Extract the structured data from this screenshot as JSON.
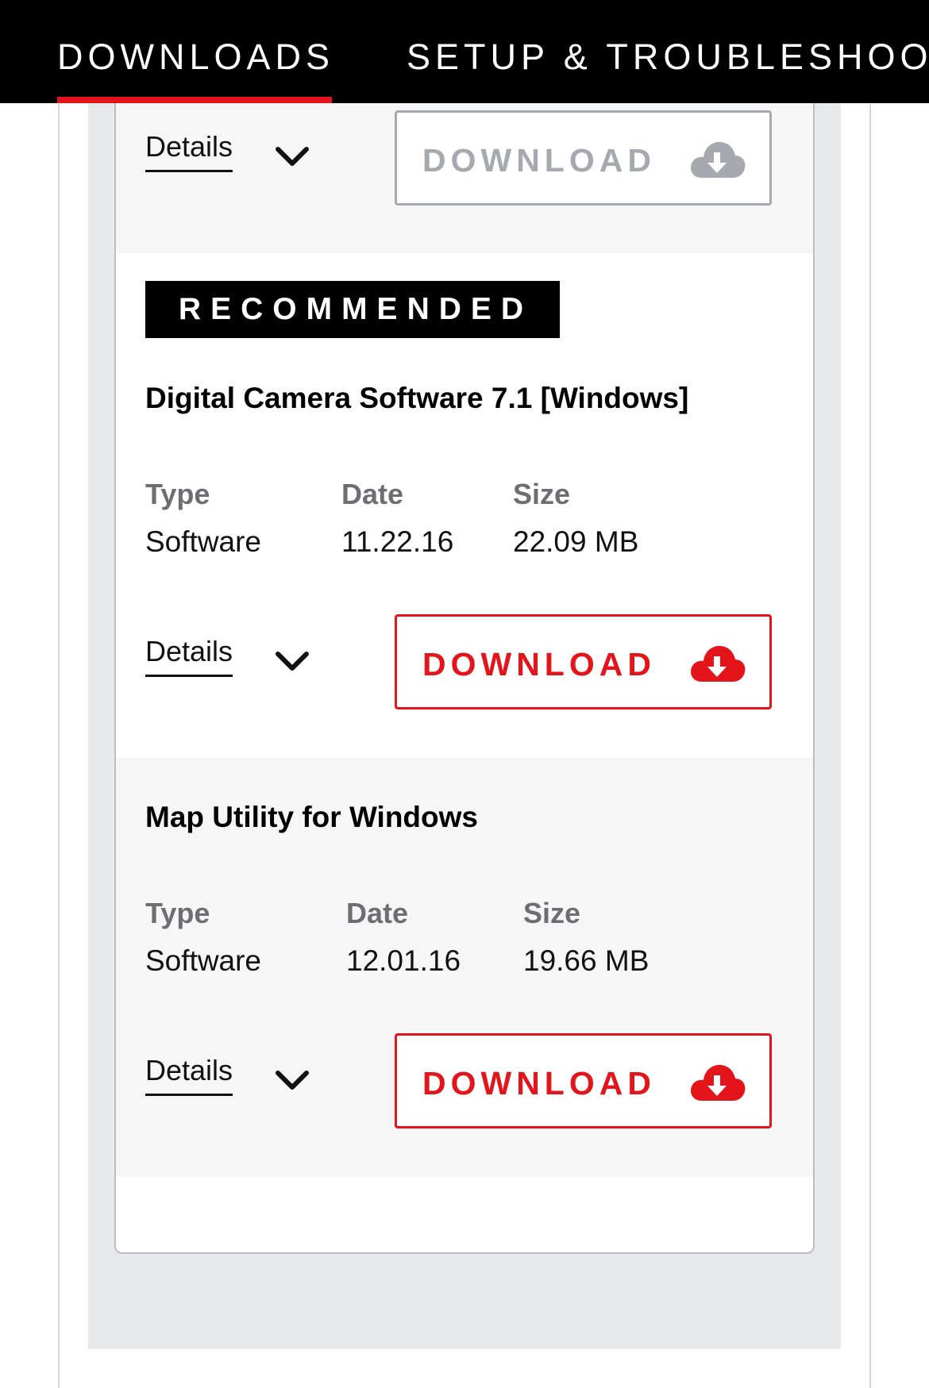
{
  "nav": {
    "tabs": [
      {
        "label": "DOWNLOADS",
        "active": true
      },
      {
        "label": "SETUP & TROUBLESHOOT",
        "active": false
      }
    ]
  },
  "colors": {
    "accent": "#e4141b",
    "disabled": "#a7a9b0",
    "nav_bg": "#000000"
  },
  "items": [
    {
      "details_label": "Details",
      "download_label": "DOWNLOAD",
      "download_state": "disabled"
    },
    {
      "badge": "RECOMMENDED",
      "title": "Digital Camera Software 7.1 [Windows]",
      "type_label": "Type",
      "type_value": "Software",
      "date_label": "Date",
      "date_value": "11.22.16",
      "size_label": "Size",
      "size_value": "22.09 MB",
      "details_label": "Details",
      "download_label": "DOWNLOAD",
      "download_state": "active"
    },
    {
      "title": "Map Utility for Windows",
      "type_label": "Type",
      "type_value": "Software",
      "date_label": "Date",
      "date_value": "12.01.16",
      "size_label": "Size",
      "size_value": "19.66 MB",
      "details_label": "Details",
      "download_label": "DOWNLOAD",
      "download_state": "active"
    }
  ],
  "icons": {
    "chevron": "chevron-down-icon",
    "cloud": "cloud-download-icon"
  }
}
